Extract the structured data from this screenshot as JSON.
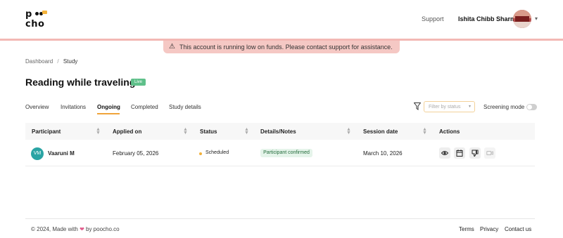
{
  "header": {
    "logo_top": "p",
    "logo_bottom": "cho",
    "support_label": "Support",
    "user_name": "Ishita Chibb Sharma",
    "caret": "▾"
  },
  "banner": {
    "icon": "⚠",
    "text": "This account is running low on funds. Please contact support for assistance."
  },
  "breadcrumb": {
    "items": [
      "Dashboard",
      "Study"
    ],
    "separator": "/"
  },
  "page": {
    "title": "Reading while traveling",
    "badge": "Live"
  },
  "tabs": [
    {
      "label": "Overview",
      "active": false
    },
    {
      "label": "Invitations",
      "active": false
    },
    {
      "label": "Ongoing",
      "active": true
    },
    {
      "label": "Completed",
      "active": false
    },
    {
      "label": "Study details",
      "active": false
    }
  ],
  "filters": {
    "status_placeholder": "Filter by status",
    "screening_label": "Screening mode",
    "screening_on": false
  },
  "table": {
    "columns": [
      "Participant",
      "Applied on",
      "Status",
      "Details/Notes",
      "Session date",
      "Actions"
    ],
    "rows": [
      {
        "initials": "VM",
        "participant": "Vaaruni M",
        "applied_on": "February 05, 2026",
        "status": "Scheduled",
        "notes": "Participant confirmed",
        "session_date": "March 10, 2026",
        "actions": [
          "eye-icon",
          "calendar-icon",
          "thumbs-down-icon",
          "video-icon"
        ]
      }
    ]
  },
  "footer": {
    "copyright_prefix": "© 2024, Made with",
    "heart": "❤",
    "copyright_suffix": "by poocho.co",
    "links": [
      "Terms",
      "Privacy",
      "Contact us"
    ]
  },
  "colors": {
    "accent": "#f0a43a",
    "banner_bg": "#f5c8c4",
    "live_badge": "#5fc08a",
    "avatar_bg": "#2aa4a4",
    "status_dot": "#f2b13c"
  }
}
